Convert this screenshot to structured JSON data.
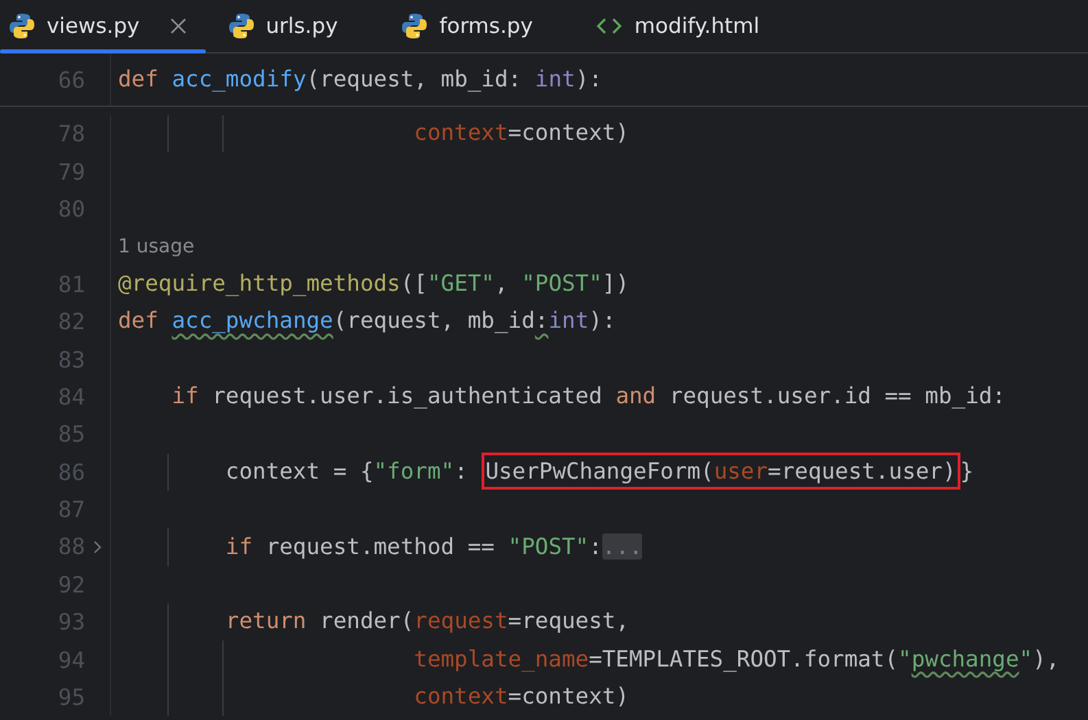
{
  "tabs": [
    {
      "label": "views.py",
      "kind": "python",
      "selected": true,
      "closable": true
    },
    {
      "label": "urls.py",
      "kind": "python",
      "selected": false,
      "closable": false
    },
    {
      "label": "forms.py",
      "kind": "python",
      "selected": false,
      "closable": false
    },
    {
      "label": "modify.html",
      "kind": "html",
      "selected": false,
      "closable": false
    }
  ],
  "sticky_line": {
    "number": "66",
    "tokens": [
      {
        "kind": "kw",
        "text": "def "
      },
      {
        "kind": "fn",
        "text": "acc_modify"
      },
      {
        "kind": "plain",
        "text": "(request, mb_id: "
      },
      {
        "kind": "builtin",
        "text": "int"
      },
      {
        "kind": "plain",
        "text": "):"
      }
    ]
  },
  "lines": [
    {
      "kind": "code",
      "number": "78",
      "tokens": [
        {
          "kind": "named",
          "text": "                      context"
        },
        {
          "kind": "plain",
          "text": "=context)"
        }
      ]
    },
    {
      "kind": "code",
      "number": "79"
    },
    {
      "kind": "code",
      "number": "80"
    },
    {
      "kind": "hint",
      "text": "1 usage"
    },
    {
      "kind": "code",
      "number": "81",
      "tokens": [
        {
          "kind": "deco",
          "text": "@require_http_methods"
        },
        {
          "kind": "plain",
          "text": "(["
        },
        {
          "kind": "str",
          "text": "\"GET\""
        },
        {
          "kind": "plain",
          "text": ", "
        },
        {
          "kind": "str",
          "text": "\"POST\""
        },
        {
          "kind": "plain",
          "text": "])"
        }
      ]
    },
    {
      "kind": "code",
      "number": "82",
      "tokens": [
        {
          "kind": "kw",
          "text": "def "
        },
        {
          "kind": "fn",
          "text": "acc_pwchange",
          "typo": true
        },
        {
          "kind": "plain",
          "text": "(request, mb_id"
        },
        {
          "kind": "plain",
          "text": ":",
          "typo": true
        },
        {
          "kind": "builtin",
          "text": "int"
        },
        {
          "kind": "plain",
          "text": "):"
        }
      ]
    },
    {
      "kind": "code",
      "number": "83"
    },
    {
      "kind": "code",
      "number": "84",
      "tokens": [
        {
          "kind": "kw",
          "text": "    if "
        },
        {
          "kind": "plain",
          "text": "request.user.is_authenticated "
        },
        {
          "kind": "kw",
          "text": "and "
        },
        {
          "kind": "plain",
          "text": "request.user.id == mb_id:"
        }
      ]
    },
    {
      "kind": "code",
      "number": "85"
    },
    {
      "kind": "code",
      "number": "86",
      "tokens": [
        {
          "kind": "plain",
          "text": "        context = {"
        },
        {
          "kind": "str",
          "text": "\"form\""
        },
        {
          "kind": "plain",
          "text": ": "
        },
        {
          "kind": "group",
          "highlighted": true,
          "tokens": [
            {
              "kind": "plain",
              "text": "UserPwChangeForm("
            },
            {
              "kind": "named",
              "text": "user"
            },
            {
              "kind": "plain",
              "text": "=request.user)"
            }
          ]
        },
        {
          "kind": "plain",
          "text": "}"
        }
      ]
    },
    {
      "kind": "code",
      "number": "87"
    },
    {
      "kind": "code",
      "number": "88",
      "foldable": true,
      "tokens": [
        {
          "kind": "kw",
          "text": "        if "
        },
        {
          "kind": "plain",
          "text": "request.method == "
        },
        {
          "kind": "str",
          "text": "\"POST\""
        },
        {
          "kind": "plain",
          "text": ":"
        },
        {
          "kind": "fold",
          "text": "..."
        }
      ]
    },
    {
      "kind": "code",
      "number": "92"
    },
    {
      "kind": "code",
      "number": "93",
      "tokens": [
        {
          "kind": "kw",
          "text": "        return "
        },
        {
          "kind": "plain",
          "text": "render("
        },
        {
          "kind": "named",
          "text": "request"
        },
        {
          "kind": "plain",
          "text": "=request,"
        }
      ]
    },
    {
      "kind": "code",
      "number": "94",
      "tokens": [
        {
          "kind": "named",
          "text": "                      template_name"
        },
        {
          "kind": "plain",
          "text": "=TEMPLATES_ROOT.format("
        },
        {
          "kind": "str",
          "text": "\""
        },
        {
          "kind": "str",
          "text": "pwchange",
          "typo": true
        },
        {
          "kind": "str",
          "text": "\""
        },
        {
          "kind": "plain",
          "text": "),"
        }
      ]
    },
    {
      "kind": "code",
      "number": "95",
      "tokens": [
        {
          "kind": "named",
          "text": "                      context"
        },
        {
          "kind": "plain",
          "text": "=context)"
        }
      ]
    }
  ]
}
